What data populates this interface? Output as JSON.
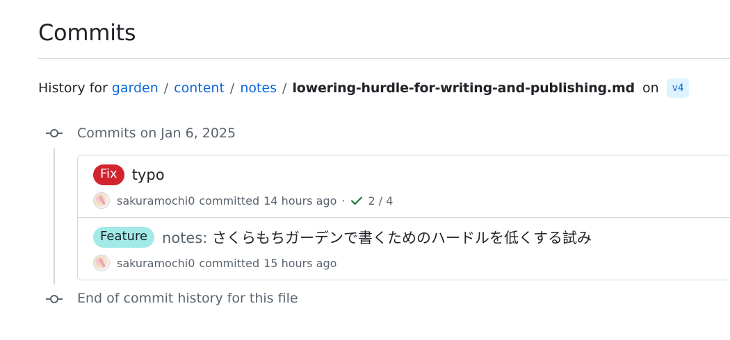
{
  "page": {
    "title": "Commits"
  },
  "history": {
    "prefix": "History for",
    "breadcrumb": [
      "garden",
      "content",
      "notes"
    ],
    "separator": "/",
    "filename": "lowering-hurdle-for-writing-and-publishing.md",
    "on_text": "on",
    "branch": "v4"
  },
  "timeline": {
    "group_heading": "Commits on Jan 6, 2025",
    "end_text": "End of commit history for this file"
  },
  "commits": [
    {
      "label": "Fix",
      "label_color": "#d1242f",
      "title_prefix": "",
      "title": "typo",
      "author": "sakuramochi0",
      "action": "committed",
      "time": "14 hours ago",
      "separator": "·",
      "check_icon": "check-icon",
      "checks": "2 / 4"
    },
    {
      "label": "Feature",
      "label_color": "#a1eae8",
      "title_prefix": "notes:",
      "title": "さくらもちガーデンで書くためのハードルを低くする試み",
      "author": "sakuramochi0",
      "action": "committed",
      "time": "15 hours ago"
    }
  ],
  "colors": {
    "link": "#0969da",
    "muted": "#59636e",
    "border": "#d1d9e0",
    "success": "#1a7f37"
  }
}
